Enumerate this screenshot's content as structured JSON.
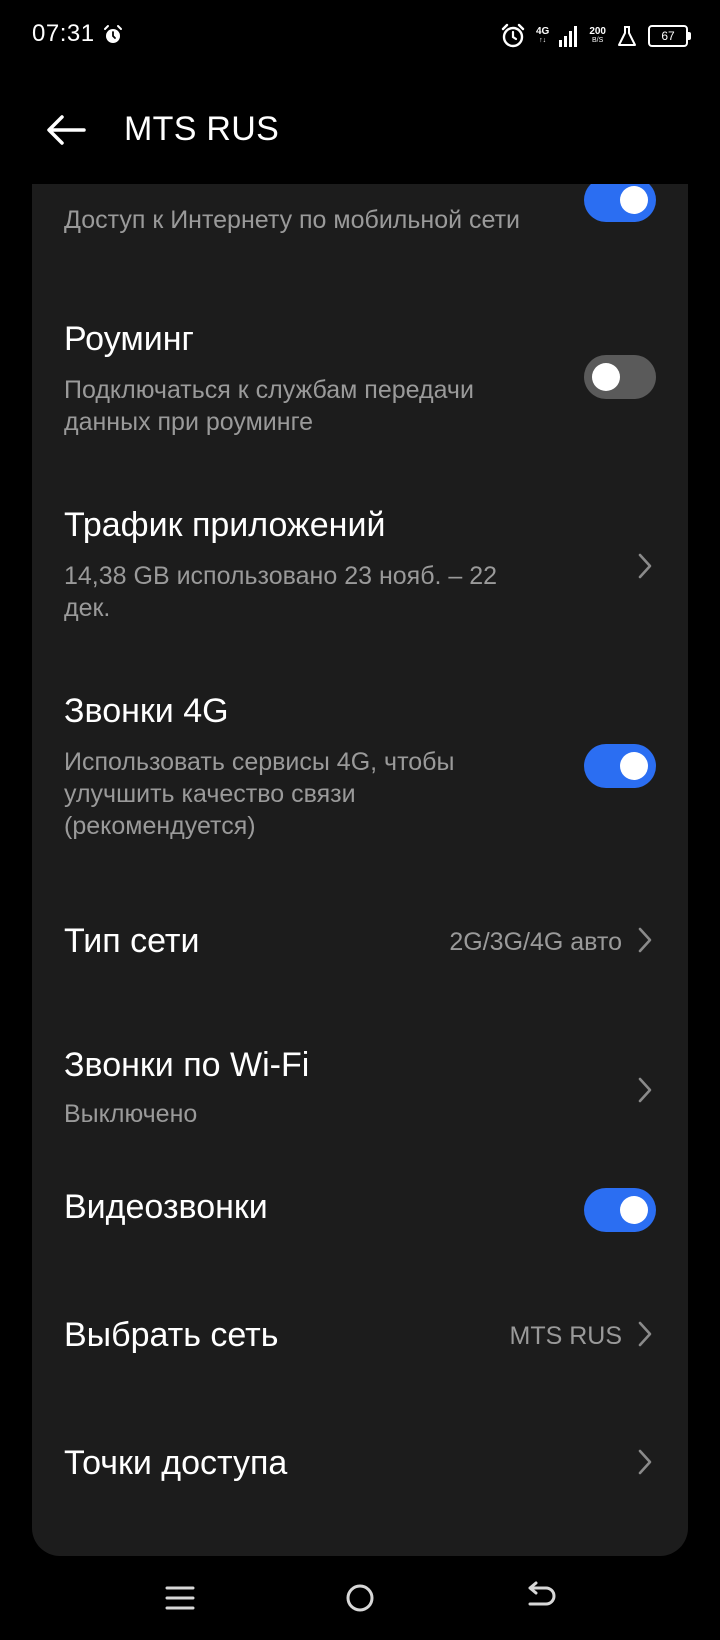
{
  "status_bar": {
    "time": "07:31",
    "network_type": "4G",
    "network_sub": "↑↓",
    "speed_value": "200",
    "speed_unit": "B/S",
    "battery": "67"
  },
  "header": {
    "title": "MTS RUS"
  },
  "settings": {
    "mobile_data": {
      "subtitle": "Доступ к Интернету по мобильной сети",
      "enabled": true
    },
    "roaming": {
      "title": "Роуминг",
      "subtitle": "Подключаться к службам передачи данных при роуминге",
      "enabled": false
    },
    "app_traffic": {
      "title": "Трафик приложений",
      "subtitle": "14,38 GB использовано 23 нояб. – 22 дек."
    },
    "calls_4g": {
      "title": "Звонки 4G",
      "subtitle": "Использовать сервисы 4G, чтобы улучшить качество связи (рекомендуется)",
      "enabled": true
    },
    "network_type": {
      "title": "Тип сети",
      "value": "2G/3G/4G авто"
    },
    "wifi_calls": {
      "title": "Звонки по Wi-Fi",
      "subtitle": "Выключено"
    },
    "video_calls": {
      "title": "Видеозвонки",
      "enabled": true
    },
    "select_network": {
      "title": "Выбрать сеть",
      "value": "MTS RUS"
    },
    "access_points": {
      "title": "Точки доступа"
    }
  },
  "colors": {
    "accent": "#2b6ef2",
    "card_bg": "#1c1c1c",
    "secondary_text": "#9a9a9a",
    "toggle_off": "#5a5a5a"
  }
}
